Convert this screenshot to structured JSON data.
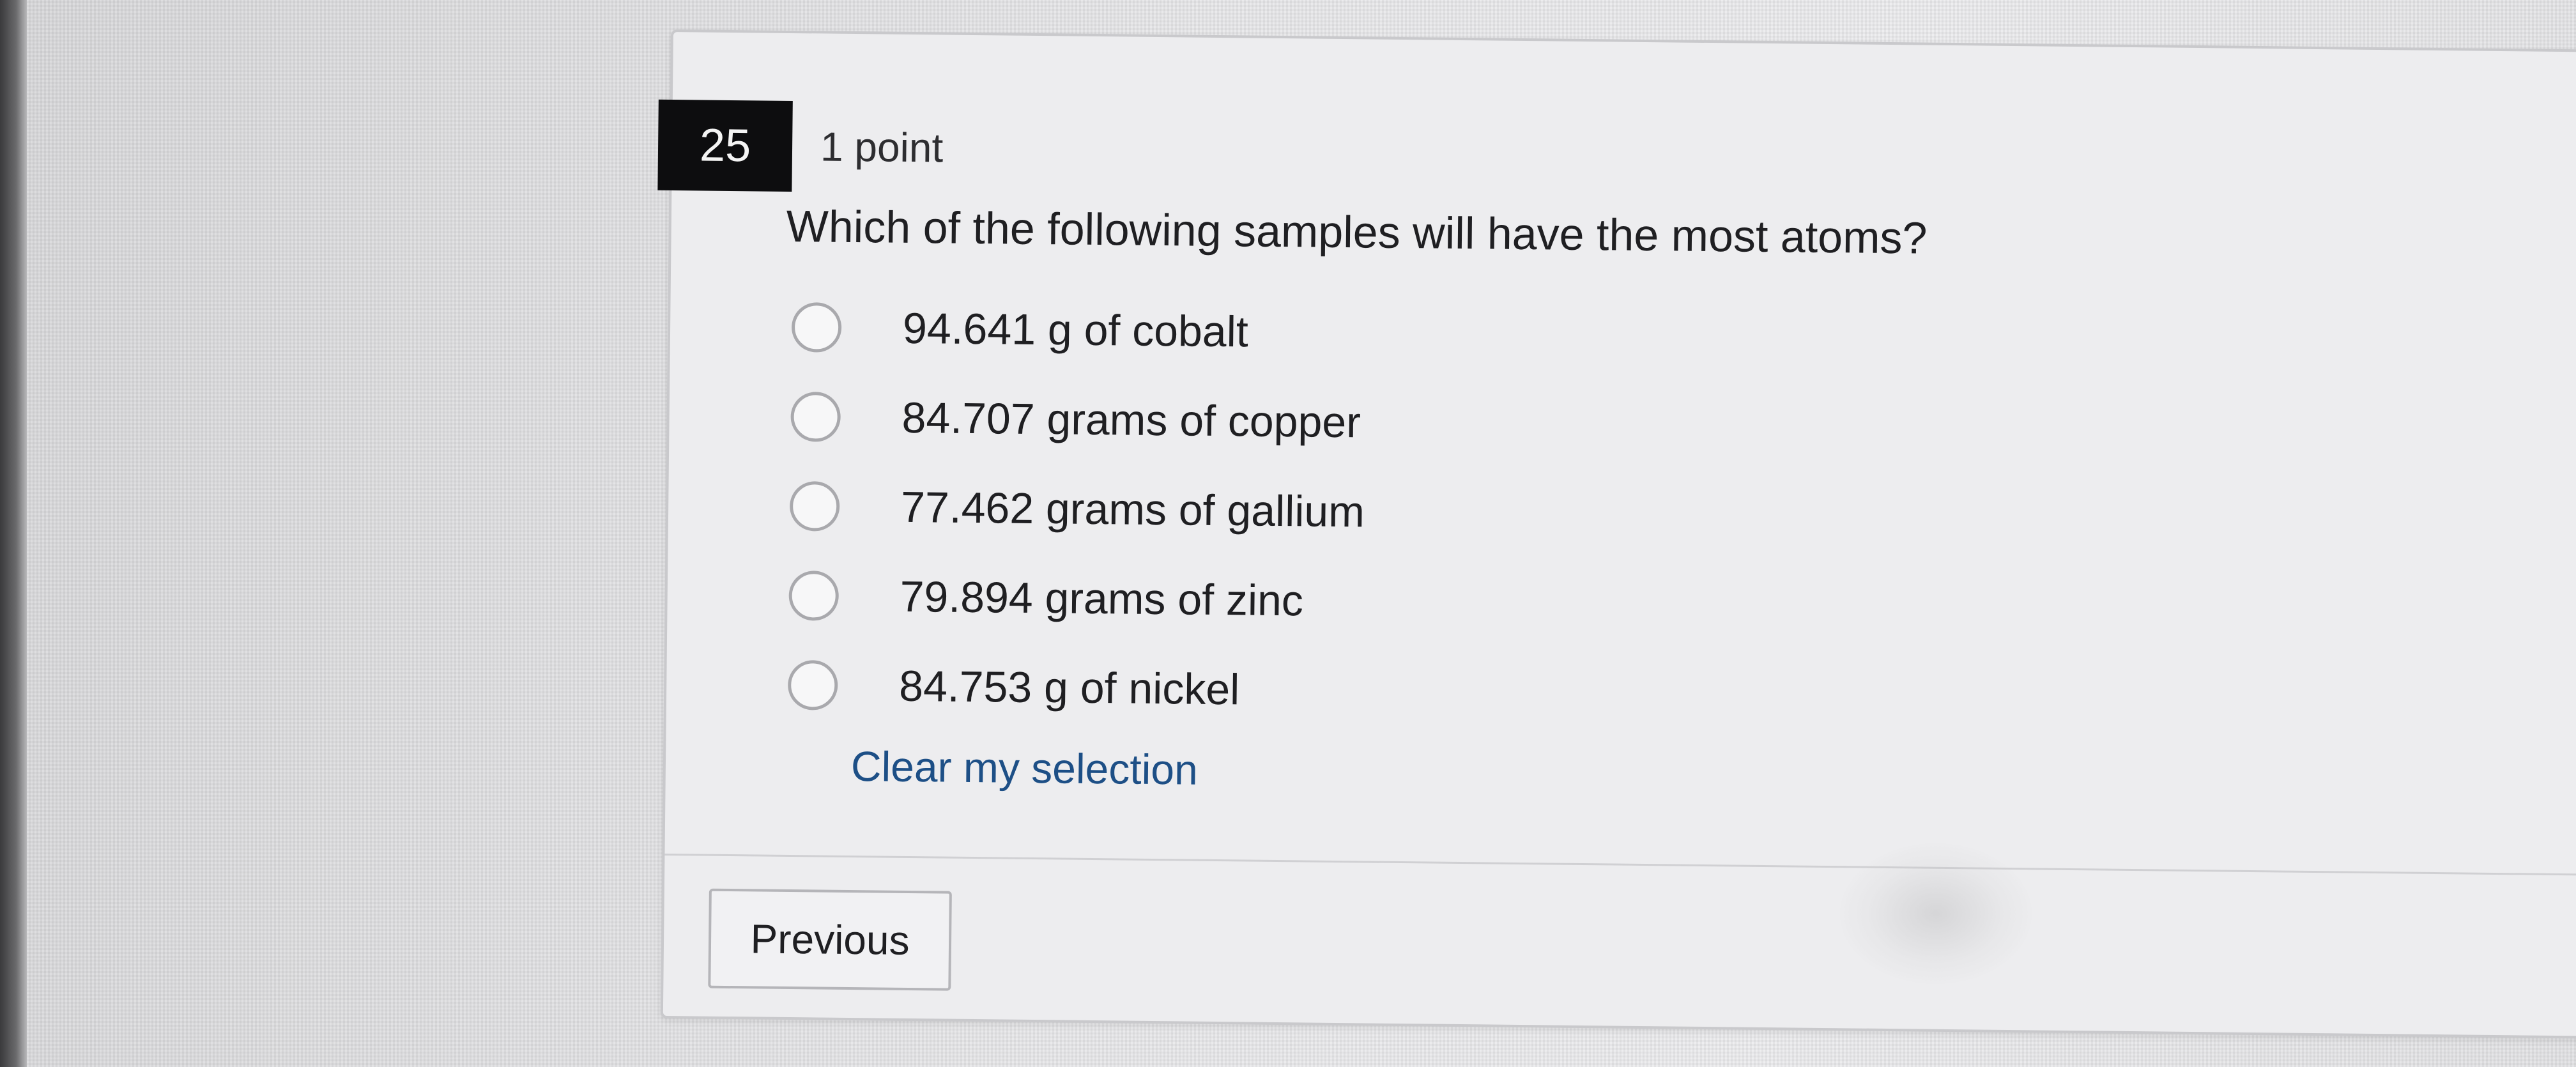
{
  "question": {
    "number": "25",
    "points": "1 point",
    "text": "Which of the following samples will have the most atoms?",
    "options": [
      {
        "label": "94.641 g of cobalt"
      },
      {
        "label": "84.707 grams of copper"
      },
      {
        "label": "77.462 grams of gallium"
      },
      {
        "label": "79.894 grams of zinc"
      },
      {
        "label": "84.753 g of nickel"
      }
    ],
    "clear_label": "Clear my selection"
  },
  "navigation": {
    "previous_label": "Previous"
  },
  "colors": {
    "link": "#1d4f86",
    "number_badge": "#0d0d0f"
  }
}
